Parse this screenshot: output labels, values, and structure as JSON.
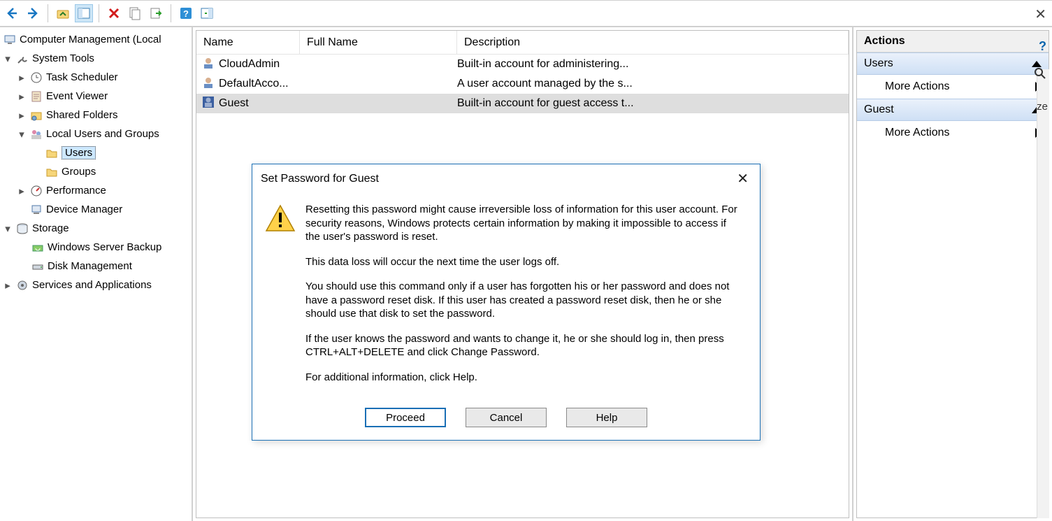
{
  "toolbar": {
    "icons": [
      "back",
      "forward",
      "up",
      "show-hide",
      "delete",
      "properties",
      "export",
      "refresh",
      "help",
      "view"
    ]
  },
  "tree": {
    "root": "Computer Management (Local",
    "system_tools": "System Tools",
    "task_scheduler": "Task Scheduler",
    "event_viewer": "Event Viewer",
    "shared_folders": "Shared Folders",
    "local_users_groups": "Local Users and Groups",
    "users": "Users",
    "groups": "Groups",
    "performance": "Performance",
    "device_manager": "Device Manager",
    "storage": "Storage",
    "wsb": "Windows Server Backup",
    "disk_mgmt": "Disk Management",
    "services_apps": "Services and Applications"
  },
  "list": {
    "headers": {
      "name": "Name",
      "full": "Full Name",
      "desc": "Description"
    },
    "rows": [
      {
        "name": "CloudAdmin",
        "full": "",
        "desc": "Built-in account for administering..."
      },
      {
        "name": "DefaultAcco...",
        "full": "",
        "desc": "A user account managed by the s..."
      },
      {
        "name": "Guest",
        "full": "",
        "desc": "Built-in account for guest access t..."
      }
    ]
  },
  "actions": {
    "title": "Actions",
    "section1": "Users",
    "more1": "More Actions",
    "section2": "Guest",
    "more2": "More Actions"
  },
  "misc": {
    "ze": "ze"
  },
  "dialog": {
    "title": "Set Password for Guest",
    "p1": "Resetting this password might cause irreversible loss of information for this user account. For security reasons, Windows protects certain information by making it impossible to access if the user's password is reset.",
    "p2": "This data loss will occur the next time the user logs off.",
    "p3": "You should use this command only if a user has forgotten his or her password and does not have a password reset disk. If this user has created a password reset disk, then he or she should use that disk to set the password.",
    "p4": "If the user knows the password and wants to change it, he or she should log in, then press CTRL+ALT+DELETE and click Change Password.",
    "p5": "For additional information, click Help.",
    "proceed": "Proceed",
    "cancel": "Cancel",
    "help": "Help"
  }
}
